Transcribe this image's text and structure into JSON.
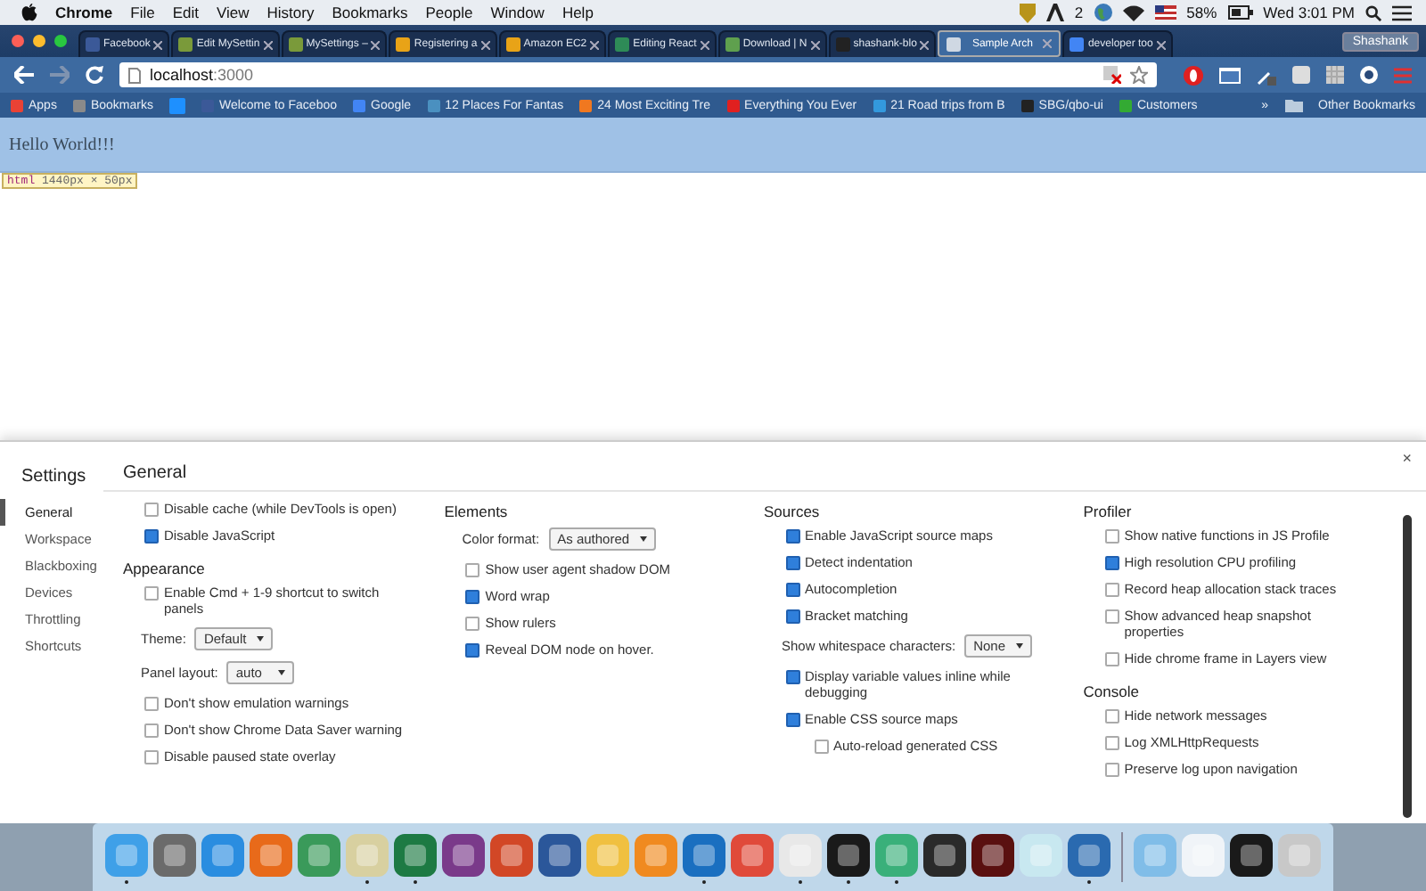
{
  "menubar": {
    "app": "Chrome",
    "items": [
      "File",
      "Edit",
      "View",
      "History",
      "Bookmarks",
      "People",
      "Window",
      "Help"
    ],
    "badge_count": "2",
    "battery": "58%",
    "clock": "Wed 3:01 PM"
  },
  "tabs": [
    {
      "title": "Facebook",
      "selected": false,
      "color": "#3b5998"
    },
    {
      "title": "Edit MySettin",
      "selected": false,
      "color": "#7a9a3a"
    },
    {
      "title": "MySettings –",
      "selected": false,
      "color": "#7a9a3a"
    },
    {
      "title": "Registering a",
      "selected": false,
      "color": "#e8a317"
    },
    {
      "title": "Amazon EC2",
      "selected": false,
      "color": "#e8a317"
    },
    {
      "title": "Editing React",
      "selected": false,
      "color": "#2e8b57"
    },
    {
      "title": "Download | N",
      "selected": false,
      "color": "#5fa04e"
    },
    {
      "title": "shashank-blo",
      "selected": false,
      "color": "#222222"
    },
    {
      "title": "Sample Arch",
      "selected": true,
      "color": "#cfd8e3"
    },
    {
      "title": "developer too",
      "selected": false,
      "color": "#4285f4"
    }
  ],
  "profile": "Shashank",
  "address": {
    "host": "localhost",
    "port": ":3000"
  },
  "bookmarks": [
    {
      "label": "Apps",
      "color": "#e94235"
    },
    {
      "label": "Bookmarks",
      "color": "#8a8a8a"
    },
    {
      "color": "#1e90ff"
    },
    {
      "label": "Welcome to Faceboo",
      "color": "#3b5998"
    },
    {
      "label": "Google",
      "color": "#4285f4"
    },
    {
      "label": "12 Places For Fantas",
      "color": "#4a90c0"
    },
    {
      "label": "24 Most Exciting Tre",
      "color": "#f07820"
    },
    {
      "label": "Everything You Ever",
      "color": "#e02020"
    },
    {
      "label": "21 Road trips from B",
      "color": "#3399dd"
    },
    {
      "label": "SBG/qbo-ui",
      "color": "#222222"
    },
    {
      "label": "Customers",
      "color": "#33aa33"
    }
  ],
  "more_bookmarks": "»",
  "other_bookmarks": "Other Bookmarks",
  "page": {
    "heading": "Hello World!!!",
    "tooltip_tag": "html",
    "tooltip_size": "1440px × 50px"
  },
  "settings": {
    "title": "Settings",
    "close": "×",
    "section_title": "General",
    "nav": [
      {
        "label": "General",
        "selected": true
      },
      {
        "label": "Workspace",
        "selected": false
      },
      {
        "label": "Blackboxing",
        "selected": false
      },
      {
        "label": "Devices",
        "selected": false
      },
      {
        "label": "Throttling",
        "selected": false
      },
      {
        "label": "Shortcuts",
        "selected": false
      }
    ],
    "columns": [
      [
        {
          "items": [
            {
              "kind": "checkbox",
              "label": "Disable cache (while DevTools is open)",
              "checked": false
            },
            {
              "kind": "checkbox",
              "label": "Disable JavaScript",
              "checked": true
            }
          ]
        },
        {
          "title": "Appearance",
          "items": [
            {
              "kind": "checkbox",
              "label": "Enable Cmd + 1-9 shortcut to switch panels",
              "checked": false
            },
            {
              "kind": "select",
              "label": "Theme:",
              "value": "Default"
            },
            {
              "kind": "select",
              "label": "Panel layout:",
              "value": "auto"
            },
            {
              "kind": "checkbox",
              "label": "Don't show emulation warnings",
              "checked": false
            },
            {
              "kind": "checkbox",
              "label": "Don't show Chrome Data Saver warning",
              "checked": false
            },
            {
              "kind": "checkbox",
              "label": "Disable paused state overlay",
              "checked": false
            }
          ]
        }
      ],
      [
        {
          "title": "Elements",
          "items": [
            {
              "kind": "select",
              "label": "Color format:",
              "value": "As authored"
            },
            {
              "kind": "checkbox",
              "label": "Show user agent shadow DOM",
              "checked": false
            },
            {
              "kind": "checkbox",
              "label": "Word wrap",
              "checked": true
            },
            {
              "kind": "checkbox",
              "label": "Show rulers",
              "checked": false
            },
            {
              "kind": "checkbox",
              "label": "Reveal DOM node on hover.",
              "checked": true
            }
          ]
        }
      ],
      [
        {
          "title": "Sources",
          "items": [
            {
              "kind": "checkbox",
              "label": "Enable JavaScript source maps",
              "checked": true
            },
            {
              "kind": "checkbox",
              "label": "Detect indentation",
              "checked": true
            },
            {
              "kind": "checkbox",
              "label": "Autocompletion",
              "checked": true
            },
            {
              "kind": "checkbox",
              "label": "Bracket matching",
              "checked": true
            },
            {
              "kind": "select",
              "label": "Show whitespace characters:",
              "value": "None"
            },
            {
              "kind": "checkbox",
              "label": "Display variable values inline while debugging",
              "checked": true
            },
            {
              "kind": "checkbox",
              "label": "Enable CSS source maps",
              "checked": true,
              "children": [
                {
                  "kind": "checkbox",
                  "label": "Auto-reload generated CSS",
                  "checked": false
                }
              ]
            }
          ]
        }
      ],
      [
        {
          "title": "Profiler",
          "items": [
            {
              "kind": "checkbox",
              "label": "Show native functions in JS Profile",
              "checked": false
            },
            {
              "kind": "checkbox",
              "label": "High resolution CPU profiling",
              "checked": true
            },
            {
              "kind": "checkbox",
              "label": "Record heap allocation stack traces",
              "checked": false
            },
            {
              "kind": "checkbox",
              "label": "Show advanced heap snapshot properties",
              "checked": false
            },
            {
              "kind": "checkbox",
              "label": "Hide chrome frame in Layers view",
              "checked": false
            }
          ]
        },
        {
          "title": "Console",
          "items": [
            {
              "kind": "checkbox",
              "label": "Hide network messages",
              "checked": false
            },
            {
              "kind": "checkbox",
              "label": "Log XMLHttpRequests",
              "checked": false
            },
            {
              "kind": "checkbox",
              "label": "Preserve log upon navigation",
              "checked": false
            }
          ]
        }
      ]
    ]
  },
  "dock": [
    {
      "color": "#3fa0e8",
      "running": true
    },
    {
      "color": "#6b6b6b",
      "running": false
    },
    {
      "color": "#2a8de0",
      "running": false
    },
    {
      "color": "#e86a1a",
      "running": false
    },
    {
      "color": "#3a9a5a",
      "running": false
    },
    {
      "color": "#d8d0a0",
      "running": true
    },
    {
      "color": "#1d7a43",
      "running": true
    },
    {
      "color": "#7a3a8a",
      "running": false
    },
    {
      "color": "#d24726",
      "running": false
    },
    {
      "color": "#2b579a",
      "running": false
    },
    {
      "color": "#f0c040",
      "running": false
    },
    {
      "color": "#f08a20",
      "running": false
    },
    {
      "color": "#1a6fc0",
      "running": true
    },
    {
      "color": "#e04a3a",
      "running": false
    },
    {
      "color": "#e8e8e8",
      "running": true
    },
    {
      "color": "#1a1a1a",
      "running": true
    },
    {
      "color": "#3ab07a",
      "running": true
    },
    {
      "color": "#2a2a2a",
      "running": false
    },
    {
      "color": "#5a1010",
      "running": false
    },
    {
      "color": "#c8e8f0",
      "running": false
    },
    {
      "color": "#2a6ab0",
      "running": true
    },
    {
      "kind": "separator"
    },
    {
      "color": "#80bde8",
      "running": false
    },
    {
      "color": "#f0f4f8",
      "running": false
    },
    {
      "color": "#1a1a1a",
      "running": false
    },
    {
      "color": "#c8c8c8",
      "running": false
    }
  ]
}
